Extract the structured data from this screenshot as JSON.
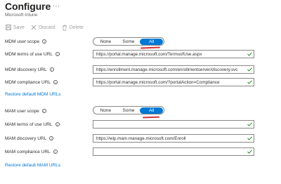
{
  "header": {
    "title": "Configure",
    "more_icon": "ellipsis-icon",
    "subtitle": "Microsoft Intune"
  },
  "toolbar": {
    "save_label": "Save",
    "discard_label": "Discard",
    "delete_label": "Delete",
    "disabled_color": "#a19f9d"
  },
  "mdm": {
    "user_scope_label": "MDM user scope",
    "scope_options": [
      "None",
      "Some",
      "All"
    ],
    "scope_selected": "All",
    "terms_label": "MDM terms of use URL",
    "terms_value": "https://portal.manage.microsoft.com/TermsofUse.aspx",
    "discovery_label": "MDM discovery URL",
    "discovery_value": "https://enrollment.manage.microsoft.com/enrollmentserver/discovery.svc",
    "compliance_label": "MDM compliance URL",
    "compliance_value": "https://portal.manage.microsoft.com/?portalAction=Compliance",
    "restore_link": "Restore default MDM URLs"
  },
  "mam": {
    "user_scope_label": "MAM user scope",
    "scope_options": [
      "None",
      "Some",
      "All"
    ],
    "scope_selected": "All",
    "terms_label": "MAM terms of use URL",
    "terms_value": "",
    "discovery_label": "MAM discovery URL",
    "discovery_value": "https://wip.mam.manage.microsoft.com/Enroll",
    "compliance_label": "MAM compliance URL",
    "compliance_value": "",
    "restore_link": "Restore default MAM URLs"
  },
  "colors": {
    "accent": "#0078d4",
    "valid_check": "#107c10",
    "annotation": "#d13438"
  }
}
